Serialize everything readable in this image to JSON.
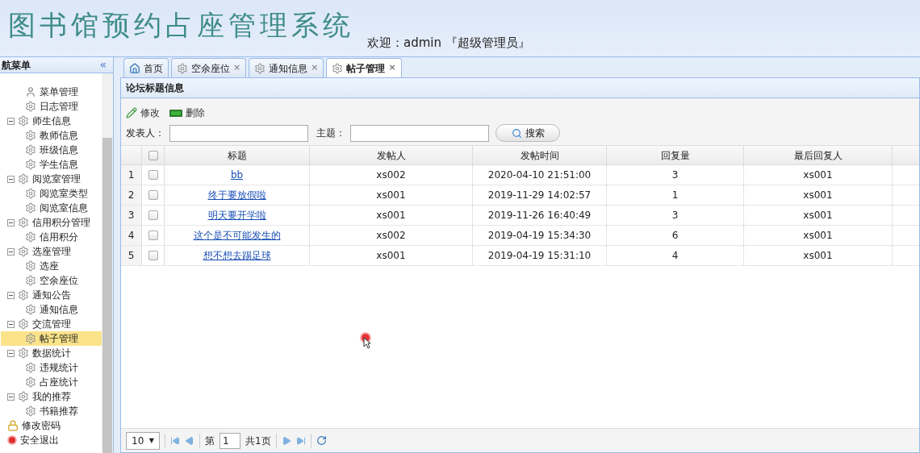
{
  "header": {
    "title": "图书馆预约占座管理系统",
    "welcome": "欢迎：admin 『超级管理员』"
  },
  "sidebar": {
    "title": "航菜单",
    "collapse": "«",
    "items": [
      {
        "kind": "group",
        "children": [
          {
            "kind": "menu",
            "label": "菜单管理",
            "selected": false
          },
          {
            "kind": "page",
            "label": "日志管理",
            "selected": false
          }
        ]
      },
      {
        "kind": "group",
        "label": "师生信息",
        "children": [
          {
            "kind": "page",
            "label": "教师信息",
            "selected": false
          },
          {
            "kind": "page",
            "label": "班级信息",
            "selected": false
          },
          {
            "kind": "page",
            "label": "学生信息",
            "selected": false
          }
        ]
      },
      {
        "kind": "group",
        "label": "阅览室管理",
        "children": [
          {
            "kind": "page",
            "label": "阅览室类型",
            "selected": false
          },
          {
            "kind": "page",
            "label": "阅览室信息",
            "selected": false
          }
        ]
      },
      {
        "kind": "group",
        "label": "信用积分管理",
        "children": [
          {
            "kind": "page",
            "label": "信用积分",
            "selected": false
          }
        ]
      },
      {
        "kind": "group",
        "label": "选座管理",
        "children": [
          {
            "kind": "page",
            "label": "选座",
            "selected": false
          },
          {
            "kind": "page",
            "label": "空余座位",
            "selected": false
          }
        ]
      },
      {
        "kind": "group",
        "label": "通知公告",
        "children": [
          {
            "kind": "page",
            "label": "通知信息",
            "selected": false
          }
        ]
      },
      {
        "kind": "group",
        "label": "交流管理",
        "children": [
          {
            "kind": "page",
            "label": "帖子管理",
            "selected": true
          }
        ]
      },
      {
        "kind": "group",
        "label": "数据统计",
        "children": [
          {
            "kind": "page",
            "label": "违规统计",
            "selected": false
          },
          {
            "kind": "page",
            "label": "占座统计",
            "selected": false
          }
        ]
      },
      {
        "kind": "group",
        "label": "我的推荐",
        "children": [
          {
            "kind": "page",
            "label": "书籍推荐",
            "selected": false
          }
        ]
      },
      {
        "kind": "lock",
        "label": "修改密码",
        "selected": false
      },
      {
        "kind": "exit",
        "label": "安全退出",
        "selected": false
      }
    ]
  },
  "tabs": [
    {
      "kind": "home",
      "label": "首页",
      "closable": false,
      "selected": false
    },
    {
      "kind": "gear",
      "label": "空余座位",
      "closable": true,
      "selected": false
    },
    {
      "kind": "gear",
      "label": "通知信息",
      "closable": true,
      "selected": false
    },
    {
      "kind": "gear",
      "label": "帖子管理",
      "closable": true,
      "selected": true
    }
  ],
  "close_mark": "×",
  "panel": {
    "title": "论坛标题信息",
    "actions": [
      {
        "kind": "edit",
        "label": "修改"
      },
      {
        "kind": "delete",
        "label": "删除"
      }
    ],
    "filters": [
      {
        "label": "发表人："
      },
      {
        "label": "主题："
      }
    ],
    "search_button": "搜索"
  },
  "table": {
    "columns": [
      "标题",
      "发帖人",
      "发帖时间",
      "回复量",
      "最后回复人"
    ],
    "header_checked": false,
    "rows": [
      {
        "num": "1",
        "checked": false,
        "cells": [
          "bb",
          "xs002",
          "2020-04-10 21:51:00",
          "3",
          "xs001"
        ]
      },
      {
        "num": "2",
        "checked": false,
        "cells": [
          "终于要放假啦",
          "xs001",
          "2019-11-29 14:02:57",
          "1",
          "xs001"
        ]
      },
      {
        "num": "3",
        "checked": false,
        "cells": [
          "明天要开学啦",
          "xs001",
          "2019-11-26 16:40:49",
          "3",
          "xs001"
        ]
      },
      {
        "num": "4",
        "checked": false,
        "cells": [
          "这个是不可能发生的",
          "xs002",
          "2019-04-19 15:34:30",
          "6",
          "xs001"
        ]
      },
      {
        "num": "5",
        "checked": false,
        "cells": [
          "想不想去踢足球",
          "xs001",
          "2019-04-19 15:31:10",
          "4",
          "xs001"
        ]
      }
    ]
  },
  "pager": {
    "page_size": "10",
    "dropdown_mark": "▼",
    "page_prefix": "第",
    "page": "1",
    "total": "共1页"
  }
}
